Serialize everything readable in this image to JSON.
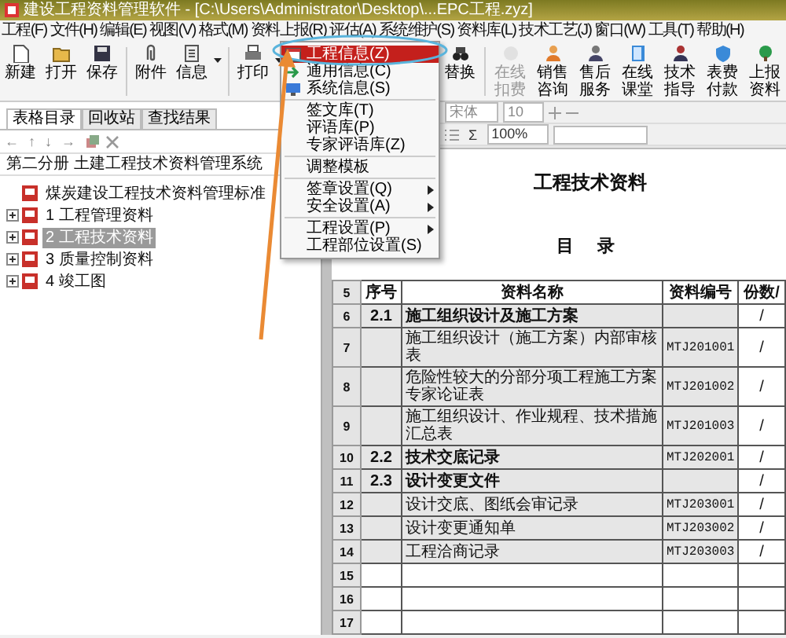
{
  "window": {
    "title": "建设工程资料管理软件 - [C:\\Users\\Administrator\\Desktop\\...EPC工程.zyz]"
  },
  "menu_bar": [
    "工程(F)",
    "文件(H)",
    "编辑(E)",
    "视图(V)",
    "格式(M)",
    "资料上报(R)",
    "评估(A)",
    "系统维护(S)",
    "资料库(L)",
    "技术工艺(J)",
    "窗口(W)",
    "工具(T)",
    "帮助(H)"
  ],
  "toolbar_left": [
    {
      "label": "新建",
      "kind": "button"
    },
    {
      "label": "打开",
      "kind": "button"
    },
    {
      "label": "保存",
      "kind": "button"
    },
    {
      "label": "附件",
      "kind": "button"
    },
    {
      "label": "信息",
      "kind": "split"
    },
    {
      "label": "打印",
      "kind": "split"
    }
  ],
  "toolbar_right": [
    {
      "label": "替换",
      "disabled": false
    },
    {
      "label": "在线扣费",
      "disabled": true
    },
    {
      "label": "销售咨询",
      "disabled": false
    },
    {
      "label": "售后服务",
      "disabled": false
    },
    {
      "label": "在线课堂",
      "disabled": false
    },
    {
      "label": "技术指导",
      "disabled": false
    },
    {
      "label": "表费付款",
      "disabled": false
    },
    {
      "label": "上报资料",
      "disabled": false
    }
  ],
  "dropdown_menu": [
    {
      "kind": "item",
      "label": "工程信息(Z)",
      "selected": true,
      "submenu": false
    },
    {
      "kind": "item",
      "label": "通用信息(C)",
      "selected": false,
      "submenu": false
    },
    {
      "kind": "item",
      "label": "系统信息(S)",
      "selected": false,
      "submenu": false
    },
    {
      "kind": "separator"
    },
    {
      "kind": "item",
      "label": "签文库(T)",
      "selected": false,
      "submenu": false
    },
    {
      "kind": "item",
      "label": "评语库(P)",
      "selected": false,
      "submenu": false
    },
    {
      "kind": "item",
      "label": "专家评语库(Z)",
      "selected": false,
      "submenu": false
    },
    {
      "kind": "separator"
    },
    {
      "kind": "item",
      "label": "调整模板",
      "selected": false,
      "submenu": false
    },
    {
      "kind": "separator"
    },
    {
      "kind": "item",
      "label": "签章设置(Q)",
      "selected": false,
      "submenu": true
    },
    {
      "kind": "item",
      "label": "安全设置(A)",
      "selected": false,
      "submenu": true
    },
    {
      "kind": "separator"
    },
    {
      "kind": "item",
      "label": "工程设置(P)",
      "selected": false,
      "submenu": true
    },
    {
      "kind": "item",
      "label": "工程部位设置(S)",
      "selected": false,
      "submenu": false
    }
  ],
  "left_panel": {
    "tabs": [
      {
        "label": "表格目录",
        "selected": true
      },
      {
        "label": "回收站",
        "selected": false
      },
      {
        "label": "查找结果",
        "selected": false
      }
    ],
    "nav_arrows": [
      "←",
      "↑",
      "↓",
      "→"
    ],
    "path": "第二分册 土建工程技术资料管理系统",
    "tree": [
      {
        "label": "煤炭建设工程技术资料管理标准",
        "selected": false
      },
      {
        "label": "1 工程管理资料",
        "selected": false,
        "expanded": false
      },
      {
        "label": "2 工程技术资料",
        "selected": true,
        "expanded": false
      },
      {
        "label": "3 质量控制资料",
        "selected": false,
        "expanded": false
      },
      {
        "label": "4 竣工图",
        "selected": false,
        "expanded": false
      }
    ]
  },
  "format_bar": {
    "font": "宋体",
    "size": "10",
    "sum": "Σ",
    "zoom": "100%"
  },
  "document": {
    "title": "工程技术资料",
    "subtitle": "目 录",
    "columns": [
      "序号",
      "资料名称",
      "资料编号",
      "份数/"
    ],
    "header_row_number": "5",
    "rows": [
      {
        "n": "6",
        "kind": "section",
        "seq": "2.1",
        "name": "施工组织设计及施工方案",
        "code": "",
        "pages": "/"
      },
      {
        "n": "7",
        "kind": "item",
        "seq": "",
        "name": "施工组织设计（施工方案）内部审核表",
        "code": "MTJ201001",
        "pages": "/"
      },
      {
        "n": "8",
        "kind": "item",
        "seq": "",
        "name": "危险性较大的分部分项工程施工方案专家论证表",
        "code": "MTJ201002",
        "pages": "/"
      },
      {
        "n": "9",
        "kind": "item",
        "seq": "",
        "name": "施工组织设计、作业规程、技术措施汇总表",
        "code": "MTJ201003",
        "pages": "/"
      },
      {
        "n": "10",
        "kind": "section",
        "seq": "2.2",
        "name": "技术交底记录",
        "code": "MTJ202001",
        "pages": "/"
      },
      {
        "n": "11",
        "kind": "section",
        "seq": "2.3",
        "name": "设计变更文件",
        "code": "",
        "pages": "/"
      },
      {
        "n": "12",
        "kind": "item",
        "seq": "",
        "name": "设计交底、图纸会审记录",
        "code": "MTJ203001",
        "pages": "/"
      },
      {
        "n": "13",
        "kind": "item",
        "seq": "",
        "name": "设计变更通知单",
        "code": "MTJ203002",
        "pages": "/"
      },
      {
        "n": "14",
        "kind": "item",
        "seq": "",
        "name": "工程洽商记录",
        "code": "MTJ203003",
        "pages": "/"
      },
      {
        "n": "15",
        "kind": "blank"
      },
      {
        "n": "16",
        "kind": "blank"
      },
      {
        "n": "17",
        "kind": "blank"
      }
    ]
  }
}
